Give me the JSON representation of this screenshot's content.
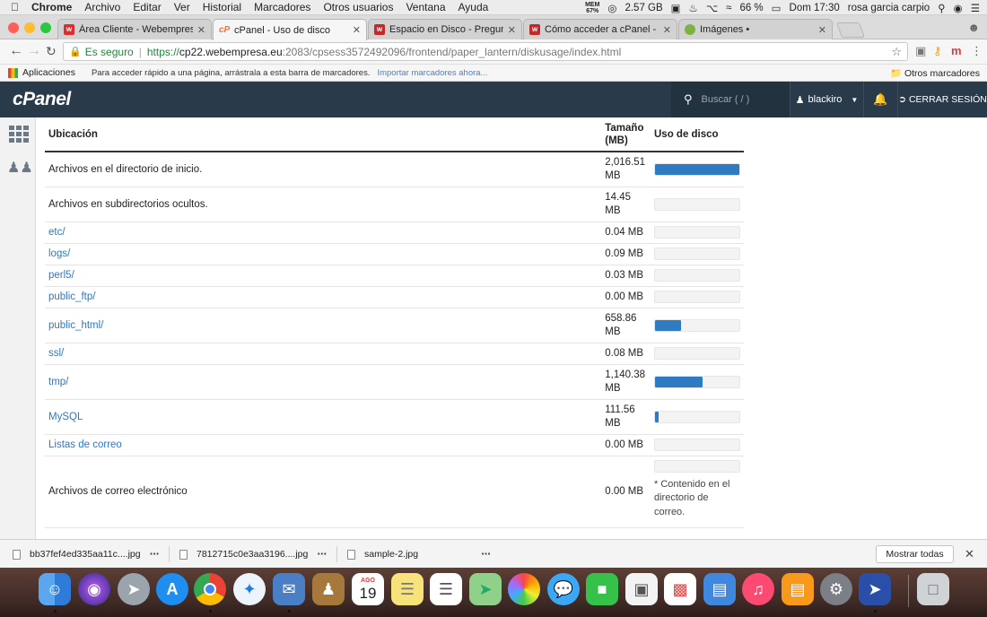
{
  "menubar": {
    "app": "Chrome",
    "items": [
      "Archivo",
      "Editar",
      "Ver",
      "Historial",
      "Marcadores",
      "Otros usuarios",
      "Ventana",
      "Ayuda"
    ],
    "mem_label": "MEM",
    "mem_value": "67%",
    "storage": "2.57 GB",
    "battery": "66 %",
    "clock": "Dom 17:30",
    "user": "rosa garcia carpio"
  },
  "tabs": [
    {
      "title": "Área Cliente - Webempresa Eu",
      "active": false,
      "favicon": "webempresa-icon",
      "color": "#e32b2b"
    },
    {
      "title": "cPanel - Uso de disco",
      "active": true,
      "favicon": "cpanel-icon",
      "color": "#ff6c2c"
    },
    {
      "title": "Espacio en Disco - Preguntas",
      "active": false,
      "favicon": "webempresa-icon",
      "color": "#c62828"
    },
    {
      "title": "Cómo acceder a cPanel - Preg",
      "active": false,
      "favicon": "webempresa-icon",
      "color": "#c62828"
    },
    {
      "title": "Imágenes •",
      "active": false,
      "favicon": "leaf-icon",
      "color": "#7cb342"
    }
  ],
  "address": {
    "secure_label": "Es seguro",
    "scheme": "https://",
    "domain": "cp22.webempresa.eu",
    "path": ":2083/cpsess3572492096/frontend/paper_lantern/diskusage/index.html"
  },
  "bookmarks": {
    "apps": "Aplicaciones",
    "hint": "Para acceder rápido a una página, arrástrala a esta barra de marcadores.",
    "import": "Importar marcadores ahora...",
    "other": "Otros marcadores"
  },
  "cpanel": {
    "logo": "cPanel",
    "search_placeholder": "Buscar ( / )",
    "user": "blackiro",
    "logout": "CERRAR SESIÓN"
  },
  "table": {
    "headers": {
      "location": "Ubicación",
      "size": "Tamaño (MB)",
      "usage": "Uso de disco"
    },
    "rows": [
      {
        "loc": "Archivos en el directorio de inicio.",
        "link": false,
        "size": "2,016.51 MB",
        "pct": 1.0
      },
      {
        "loc": "Archivos en subdirectorios ocultos.",
        "link": false,
        "size": "14.45 MB",
        "pct": 0.0
      },
      {
        "loc": "etc/",
        "link": true,
        "size": "0.04 MB",
        "pct": 0.0
      },
      {
        "loc": "logs/",
        "link": true,
        "size": "0.09 MB",
        "pct": 0.0
      },
      {
        "loc": "perl5/",
        "link": true,
        "size": "0.03 MB",
        "pct": 0.0
      },
      {
        "loc": "public_ftp/",
        "link": true,
        "size": "0.00 MB",
        "pct": 0.0
      },
      {
        "loc": "public_html/",
        "link": true,
        "size": "658.86 MB",
        "pct": 0.31
      },
      {
        "loc": "ssl/",
        "link": true,
        "size": "0.08 MB",
        "pct": 0.0
      },
      {
        "loc": "tmp/",
        "link": true,
        "size": "1,140.38 MB",
        "pct": 0.56
      },
      {
        "loc": "MySQL",
        "link": true,
        "size": "111.56 MB",
        "pct": 0.04
      },
      {
        "loc": "Listas de correo",
        "link": true,
        "size": "0.00 MB",
        "pct": 0.0
      },
      {
        "loc": "Archivos de correo electrónico",
        "link": false,
        "size": "0.00 MB",
        "pct": 0.0,
        "note": "* Contenido en el directorio de correo."
      }
    ]
  },
  "downloads": {
    "items": [
      "bb37fef4ed335aa11c....jpg",
      "7812715c0e3aa3196....jpg",
      "sample-2.jpg"
    ],
    "show_all": "Mostrar todas"
  },
  "dock": {
    "calendar_month": "AGO",
    "calendar_day": "19"
  }
}
